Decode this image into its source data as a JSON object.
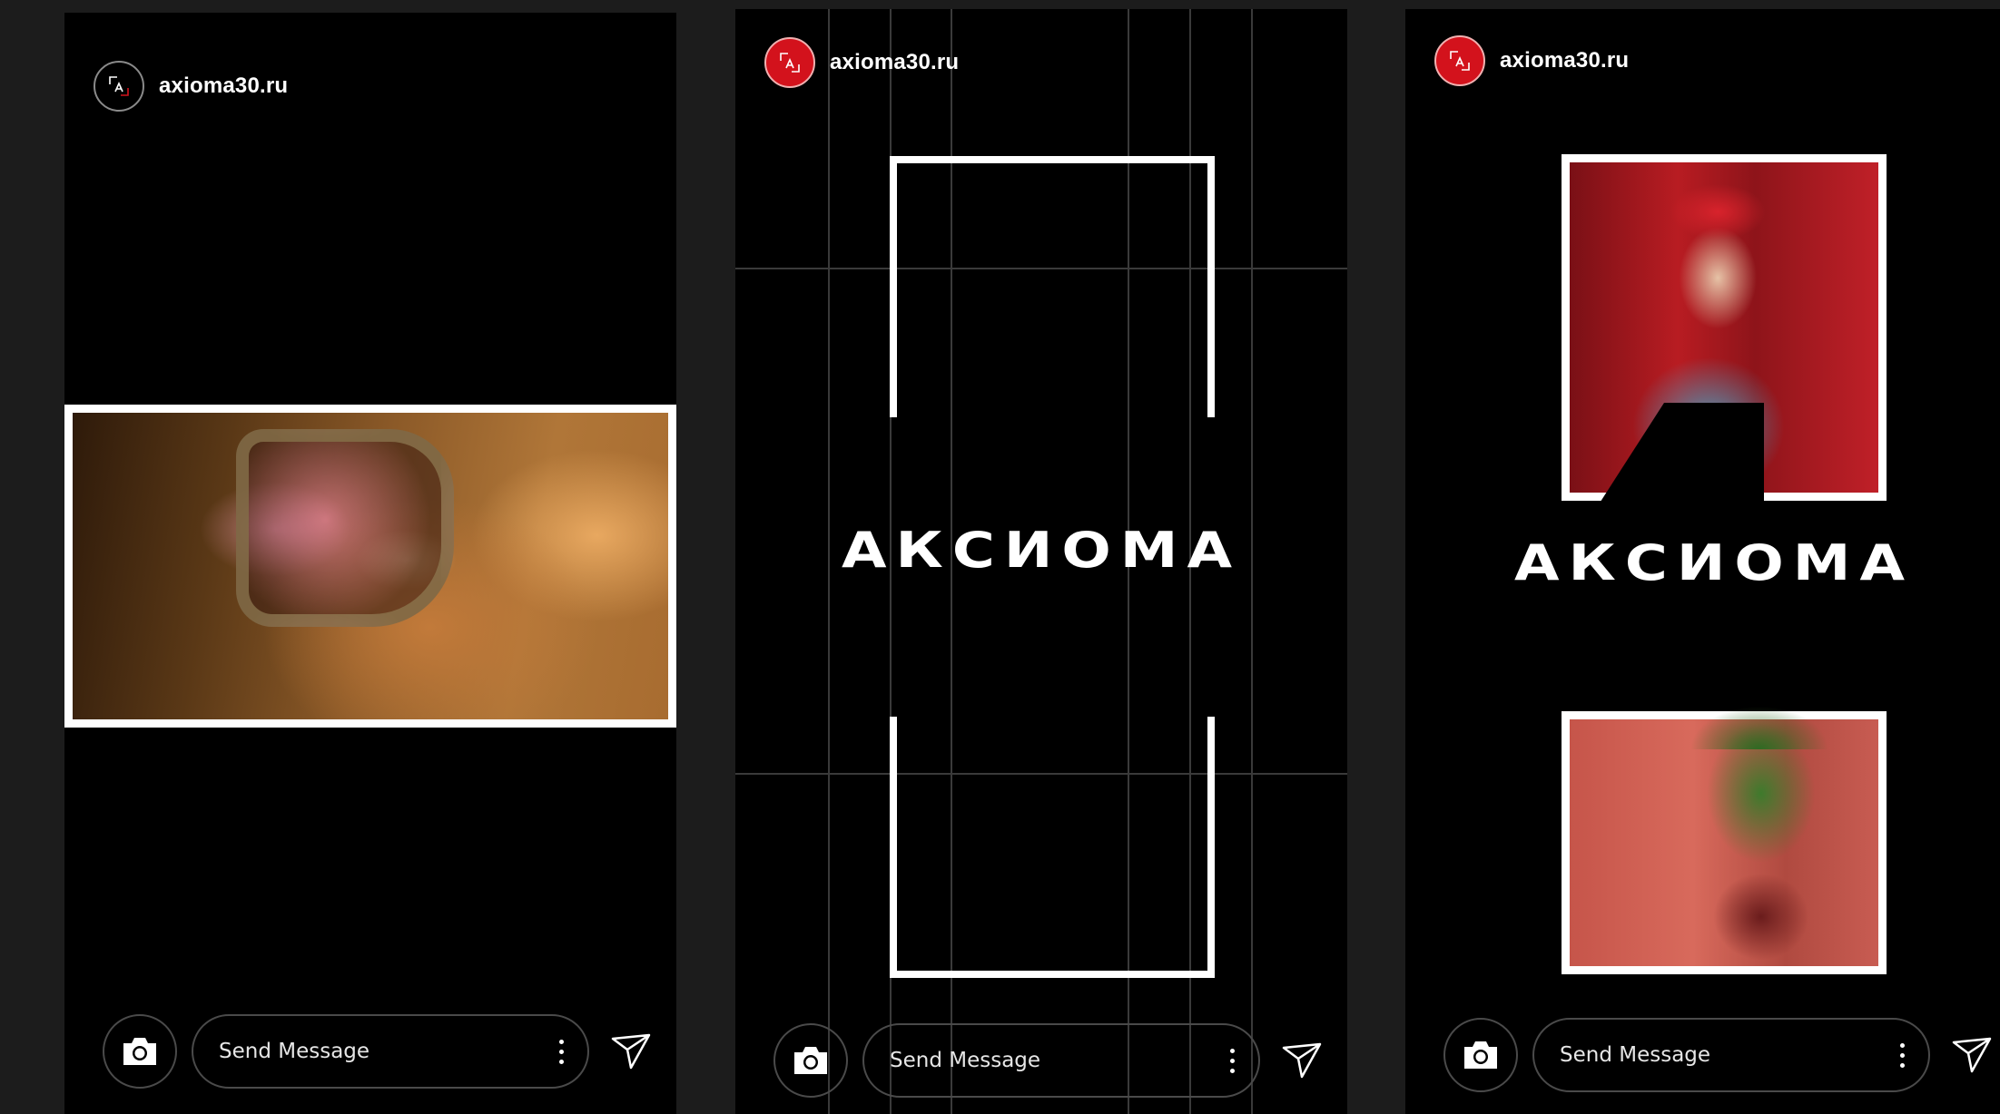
{
  "stories": [
    {
      "username": "axioma30.ru",
      "message_placeholder": "Send Message"
    },
    {
      "username": "axioma30.ru",
      "brand_word": "АКСИОМА",
      "message_placeholder": "Send Message"
    },
    {
      "username": "axioma30.ru",
      "brand_word": "АКСИОМА",
      "message_placeholder": "Send Message"
    }
  ],
  "colors": {
    "background": "#1c1c1c",
    "story_bg": "#000000",
    "brand_red": "#d3121c",
    "frame_white": "#ffffff",
    "grid_line": "#3a3a3a"
  },
  "icons": [
    "camera-icon",
    "more-dots-icon",
    "send-icon",
    "avatar-logo-icon"
  ]
}
